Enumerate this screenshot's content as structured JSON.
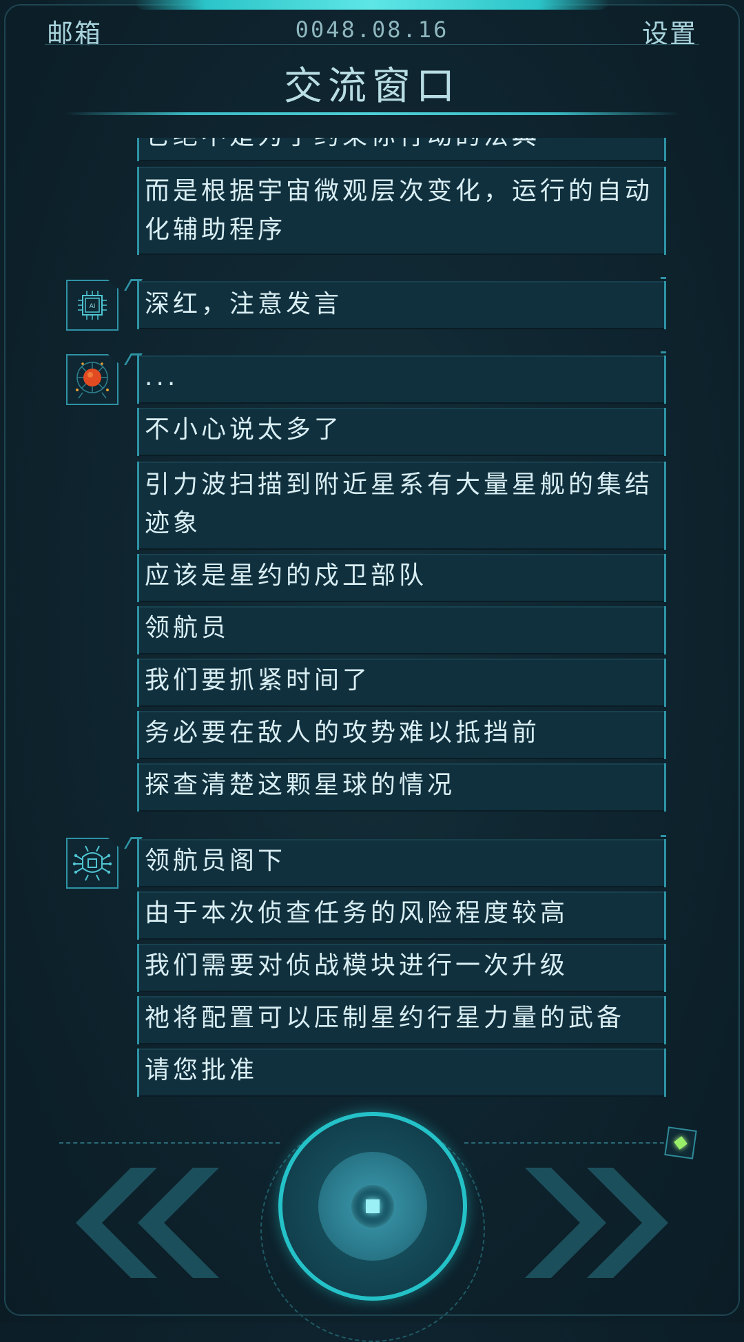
{
  "header": {
    "mail_label": "邮箱",
    "date": "0048.08.16",
    "settings_label": "设置",
    "title": "交流窗口"
  },
  "chat": {
    "groups": [
      {
        "speaker_icon": "none",
        "messages": [
          "它绝不是为了约束你行动的法典",
          "而是根据宇宙微观层次变化，运行的自动化辅助程序"
        ]
      },
      {
        "speaker_icon": "ai-chip-icon",
        "messages": [
          "深红，注意发言"
        ]
      },
      {
        "speaker_icon": "red-orb-network-icon",
        "messages": [
          "...",
          "不小心说太多了",
          "引力波扫描到附近星系有大量星舰的集结迹象",
          "应该是星约的戍卫部队",
          "领航员",
          "我们要抓紧时间了",
          "务必要在敌人的攻势难以抵挡前",
          "探查清楚这颗星球的情况"
        ]
      },
      {
        "speaker_icon": "circuit-bug-icon",
        "messages": [
          "领航员阁下",
          "由于本次侦查任务的风险程度较高",
          "我们需要对侦战模块进行一次升级",
          "祂将配置可以压制星约行星力量的武备",
          "请您批准"
        ]
      }
    ]
  },
  "controls": {
    "prev_icon": "double-chevron-left-icon",
    "next_icon": "double-chevron-right-icon",
    "center_icon": "stop-square-icon",
    "gem_icon": "green-diamond-icon"
  },
  "colors": {
    "accent": "#24c2c8",
    "bubble": "#10303e",
    "bubble_border": "#2e93a5",
    "text": "#d9eef3",
    "gem": "#9bf06a",
    "red_orb": "#e24a22"
  }
}
